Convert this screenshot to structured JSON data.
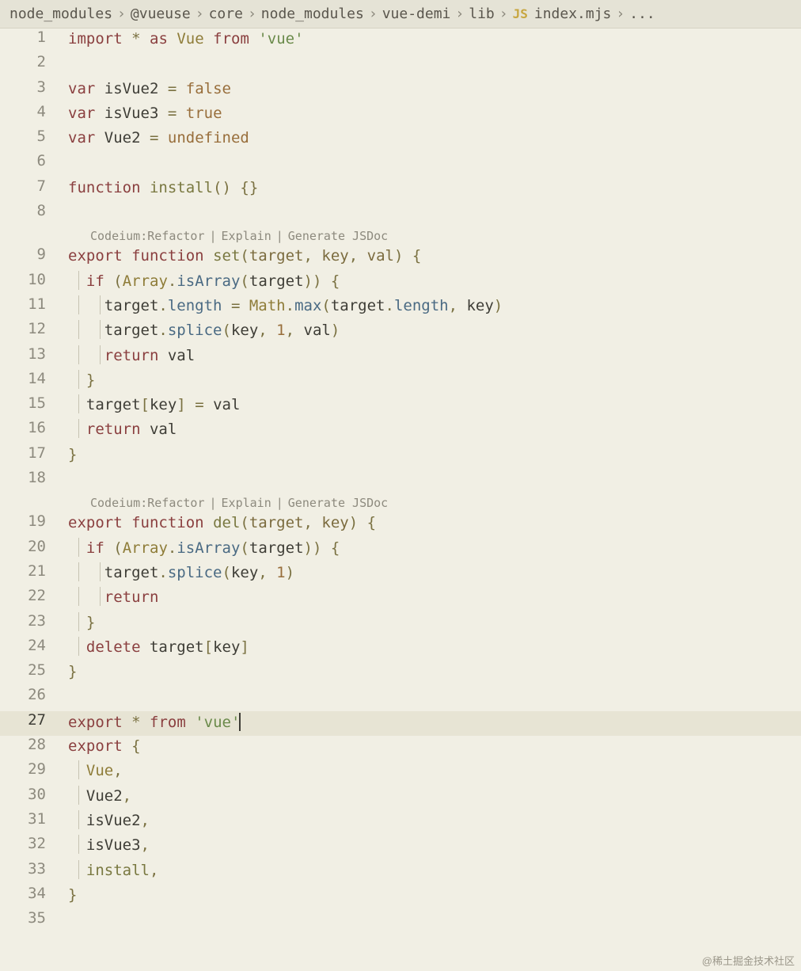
{
  "breadcrumb": {
    "items": [
      "node_modules",
      "@vueuse",
      "core",
      "node_modules",
      "vue-demi",
      "lib"
    ],
    "fileBadge": "JS",
    "file": "index.mjs",
    "overflow": "..."
  },
  "codelens": {
    "prefix": "Codeium:",
    "items": [
      "Refactor",
      "Explain",
      "Generate JSDoc"
    ]
  },
  "lines": [
    {
      "n": 1,
      "t": [
        [
          "kw",
          "import"
        ],
        [
          "var",
          " "
        ],
        [
          "op",
          "*"
        ],
        [
          "var",
          " "
        ],
        [
          "kw",
          "as"
        ],
        [
          "var",
          " "
        ],
        [
          "cls",
          "Vue"
        ],
        [
          "var",
          " "
        ],
        [
          "kw",
          "from"
        ],
        [
          "var",
          " "
        ],
        [
          "str",
          "'vue'"
        ]
      ]
    },
    {
      "n": 2,
      "t": []
    },
    {
      "n": 3,
      "t": [
        [
          "kw",
          "var"
        ],
        [
          "var",
          " isVue2 "
        ],
        [
          "op",
          "="
        ],
        [
          "var",
          " "
        ],
        [
          "bool",
          "false"
        ]
      ]
    },
    {
      "n": 4,
      "t": [
        [
          "kw",
          "var"
        ],
        [
          "var",
          " isVue3 "
        ],
        [
          "op",
          "="
        ],
        [
          "var",
          " "
        ],
        [
          "bool",
          "true"
        ]
      ]
    },
    {
      "n": 5,
      "t": [
        [
          "kw",
          "var"
        ],
        [
          "var",
          " Vue2 "
        ],
        [
          "op",
          "="
        ],
        [
          "var",
          " "
        ],
        [
          "bool",
          "undefined"
        ]
      ]
    },
    {
      "n": 6,
      "t": []
    },
    {
      "n": 7,
      "t": [
        [
          "kw",
          "function"
        ],
        [
          "var",
          " "
        ],
        [
          "fn",
          "install"
        ],
        [
          "op",
          "()"
        ],
        [
          "var",
          " "
        ],
        [
          "op",
          "{}"
        ]
      ]
    },
    {
      "n": 8,
      "t": []
    },
    {
      "codelens": true
    },
    {
      "n": 9,
      "t": [
        [
          "kw",
          "export"
        ],
        [
          "var",
          " "
        ],
        [
          "kw",
          "function"
        ],
        [
          "var",
          " "
        ],
        [
          "fn",
          "set"
        ],
        [
          "op",
          "("
        ],
        [
          "prm",
          "target"
        ],
        [
          "op",
          ","
        ],
        [
          "var",
          " "
        ],
        [
          "prm",
          "key"
        ],
        [
          "op",
          ","
        ],
        [
          "var",
          " "
        ],
        [
          "prm",
          "val"
        ],
        [
          "op",
          ")"
        ],
        [
          "var",
          " "
        ],
        [
          "op",
          "{"
        ]
      ]
    },
    {
      "n": 10,
      "g": [
        1
      ],
      "t": [
        [
          "var",
          "  "
        ],
        [
          "kw",
          "if"
        ],
        [
          "var",
          " "
        ],
        [
          "op",
          "("
        ],
        [
          "cls",
          "Array"
        ],
        [
          "op",
          "."
        ],
        [
          "prop",
          "isArray"
        ],
        [
          "op",
          "("
        ],
        [
          "var",
          "target"
        ],
        [
          "op",
          "))"
        ],
        [
          "var",
          " "
        ],
        [
          "op",
          "{"
        ]
      ]
    },
    {
      "n": 11,
      "g": [
        1,
        2
      ],
      "t": [
        [
          "var",
          "    target"
        ],
        [
          "op",
          "."
        ],
        [
          "prop",
          "length"
        ],
        [
          "var",
          " "
        ],
        [
          "op",
          "="
        ],
        [
          "var",
          " "
        ],
        [
          "cls",
          "Math"
        ],
        [
          "op",
          "."
        ],
        [
          "prop",
          "max"
        ],
        [
          "op",
          "("
        ],
        [
          "var",
          "target"
        ],
        [
          "op",
          "."
        ],
        [
          "prop",
          "length"
        ],
        [
          "op",
          ","
        ],
        [
          "var",
          " key"
        ],
        [
          "op",
          ")"
        ]
      ]
    },
    {
      "n": 12,
      "g": [
        1,
        2
      ],
      "t": [
        [
          "var",
          "    target"
        ],
        [
          "op",
          "."
        ],
        [
          "prop",
          "splice"
        ],
        [
          "op",
          "("
        ],
        [
          "var",
          "key"
        ],
        [
          "op",
          ","
        ],
        [
          "var",
          " "
        ],
        [
          "num",
          "1"
        ],
        [
          "op",
          ","
        ],
        [
          "var",
          " val"
        ],
        [
          "op",
          ")"
        ]
      ]
    },
    {
      "n": 13,
      "g": [
        1,
        2
      ],
      "t": [
        [
          "var",
          "    "
        ],
        [
          "kw",
          "return"
        ],
        [
          "var",
          " val"
        ]
      ]
    },
    {
      "n": 14,
      "g": [
        1
      ],
      "t": [
        [
          "var",
          "  "
        ],
        [
          "op",
          "}"
        ]
      ]
    },
    {
      "n": 15,
      "g": [
        1
      ],
      "t": [
        [
          "var",
          "  target"
        ],
        [
          "op",
          "["
        ],
        [
          "var",
          "key"
        ],
        [
          "op",
          "]"
        ],
        [
          "var",
          " "
        ],
        [
          "op",
          "="
        ],
        [
          "var",
          " val"
        ]
      ]
    },
    {
      "n": 16,
      "g": [
        1
      ],
      "t": [
        [
          "var",
          "  "
        ],
        [
          "kw",
          "return"
        ],
        [
          "var",
          " val"
        ]
      ]
    },
    {
      "n": 17,
      "t": [
        [
          "op",
          "}"
        ]
      ]
    },
    {
      "n": 18,
      "t": []
    },
    {
      "codelens": true
    },
    {
      "n": 19,
      "t": [
        [
          "kw",
          "export"
        ],
        [
          "var",
          " "
        ],
        [
          "kw",
          "function"
        ],
        [
          "var",
          " "
        ],
        [
          "fn",
          "del"
        ],
        [
          "op",
          "("
        ],
        [
          "prm",
          "target"
        ],
        [
          "op",
          ","
        ],
        [
          "var",
          " "
        ],
        [
          "prm",
          "key"
        ],
        [
          "op",
          ")"
        ],
        [
          "var",
          " "
        ],
        [
          "op",
          "{"
        ]
      ]
    },
    {
      "n": 20,
      "g": [
        1
      ],
      "t": [
        [
          "var",
          "  "
        ],
        [
          "kw",
          "if"
        ],
        [
          "var",
          " "
        ],
        [
          "op",
          "("
        ],
        [
          "cls",
          "Array"
        ],
        [
          "op",
          "."
        ],
        [
          "prop",
          "isArray"
        ],
        [
          "op",
          "("
        ],
        [
          "var",
          "target"
        ],
        [
          "op",
          "))"
        ],
        [
          "var",
          " "
        ],
        [
          "op",
          "{"
        ]
      ]
    },
    {
      "n": 21,
      "g": [
        1,
        2
      ],
      "t": [
        [
          "var",
          "    target"
        ],
        [
          "op",
          "."
        ],
        [
          "prop",
          "splice"
        ],
        [
          "op",
          "("
        ],
        [
          "var",
          "key"
        ],
        [
          "op",
          ","
        ],
        [
          "var",
          " "
        ],
        [
          "num",
          "1"
        ],
        [
          "op",
          ")"
        ]
      ]
    },
    {
      "n": 22,
      "g": [
        1,
        2
      ],
      "t": [
        [
          "var",
          "    "
        ],
        [
          "kw",
          "return"
        ]
      ]
    },
    {
      "n": 23,
      "g": [
        1
      ],
      "t": [
        [
          "var",
          "  "
        ],
        [
          "op",
          "}"
        ]
      ]
    },
    {
      "n": 24,
      "g": [
        1
      ],
      "t": [
        [
          "var",
          "  "
        ],
        [
          "kw",
          "delete"
        ],
        [
          "var",
          " target"
        ],
        [
          "op",
          "["
        ],
        [
          "var",
          "key"
        ],
        [
          "op",
          "]"
        ]
      ]
    },
    {
      "n": 25,
      "t": [
        [
          "op",
          "}"
        ]
      ]
    },
    {
      "n": 26,
      "t": []
    },
    {
      "n": 27,
      "hl": true,
      "t": [
        [
          "kw",
          "export"
        ],
        [
          "var",
          " "
        ],
        [
          "op",
          "*"
        ],
        [
          "var",
          " "
        ],
        [
          "kw",
          "from"
        ],
        [
          "var",
          " "
        ],
        [
          "str",
          "'vue'"
        ],
        [
          "cursor",
          ""
        ]
      ]
    },
    {
      "n": 28,
      "t": [
        [
          "kw",
          "export"
        ],
        [
          "var",
          " "
        ],
        [
          "op",
          "{"
        ]
      ]
    },
    {
      "n": 29,
      "g": [
        1
      ],
      "t": [
        [
          "var",
          "  "
        ],
        [
          "cls",
          "Vue"
        ],
        [
          "op",
          ","
        ]
      ]
    },
    {
      "n": 30,
      "g": [
        1
      ],
      "t": [
        [
          "var",
          "  Vue2"
        ],
        [
          "op",
          ","
        ]
      ]
    },
    {
      "n": 31,
      "g": [
        1
      ],
      "t": [
        [
          "var",
          "  isVue2"
        ],
        [
          "op",
          ","
        ]
      ]
    },
    {
      "n": 32,
      "g": [
        1
      ],
      "t": [
        [
          "var",
          "  isVue3"
        ],
        [
          "op",
          ","
        ]
      ]
    },
    {
      "n": 33,
      "g": [
        1
      ],
      "t": [
        [
          "var",
          "  "
        ],
        [
          "fn",
          "install"
        ],
        [
          "op",
          ","
        ]
      ]
    },
    {
      "n": 34,
      "t": [
        [
          "op",
          "}"
        ]
      ]
    },
    {
      "n": 35,
      "t": []
    }
  ],
  "watermark": "@稀土掘金技术社区"
}
